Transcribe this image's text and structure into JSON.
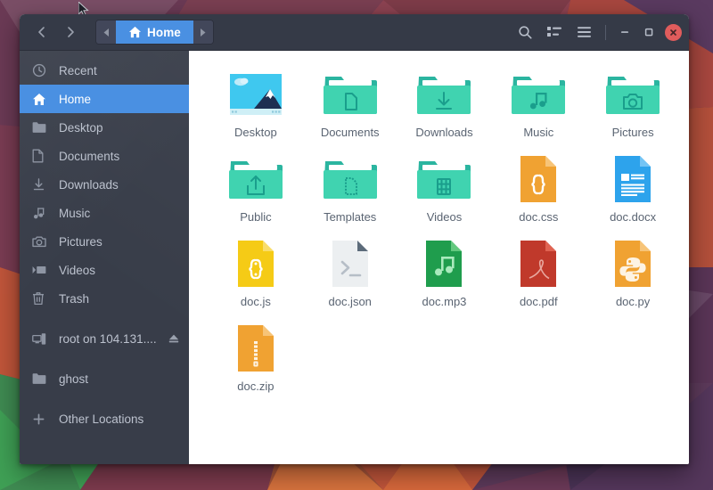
{
  "window": {
    "title": "Home",
    "accent_color": "#4a90e2",
    "headerbar_color": "#353a47",
    "sidebar_color": "#383d49",
    "close_color": "#e05c5c"
  },
  "headerbar": {
    "back_label": "Back",
    "forward_label": "Forward",
    "path_prev_label": "Previous path",
    "path_next_label": "Next path",
    "crumb_label": "Home",
    "search_label": "Search",
    "view_toggle_label": "List view",
    "menu_label": "Menu",
    "minimize_label": "Minimize",
    "maximize_label": "Maximize",
    "close_label": "Close"
  },
  "sidebar": {
    "items": [
      {
        "label": "Recent",
        "icon": "clock-icon",
        "selected": false,
        "gap_before": false,
        "eject": false
      },
      {
        "label": "Home",
        "icon": "home-icon",
        "selected": true,
        "gap_before": false,
        "eject": false
      },
      {
        "label": "Desktop",
        "icon": "folder-icon",
        "selected": false,
        "gap_before": false,
        "eject": false
      },
      {
        "label": "Documents",
        "icon": "document-icon",
        "selected": false,
        "gap_before": false,
        "eject": false
      },
      {
        "label": "Downloads",
        "icon": "download-icon",
        "selected": false,
        "gap_before": false,
        "eject": false
      },
      {
        "label": "Music",
        "icon": "music-icon",
        "selected": false,
        "gap_before": false,
        "eject": false
      },
      {
        "label": "Pictures",
        "icon": "camera-icon",
        "selected": false,
        "gap_before": false,
        "eject": false
      },
      {
        "label": "Videos",
        "icon": "video-icon",
        "selected": false,
        "gap_before": false,
        "eject": false
      },
      {
        "label": "Trash",
        "icon": "trash-icon",
        "selected": false,
        "gap_before": false,
        "eject": false
      },
      {
        "label": "root on 104.131....",
        "icon": "server-icon",
        "selected": false,
        "gap_before": true,
        "eject": true
      },
      {
        "label": "ghost",
        "icon": "folder-icon",
        "selected": false,
        "gap_before": true,
        "eject": false
      },
      {
        "label": "Other Locations",
        "icon": "plus-icon",
        "selected": false,
        "gap_before": true,
        "eject": false
      }
    ]
  },
  "files": {
    "items": [
      {
        "name": "Desktop",
        "icon": "wallpaper-thumbnail-icon"
      },
      {
        "name": "Documents",
        "icon": "folder-documents-icon"
      },
      {
        "name": "Downloads",
        "icon": "folder-downloads-icon"
      },
      {
        "name": "Music",
        "icon": "folder-music-icon"
      },
      {
        "name": "Pictures",
        "icon": "folder-pictures-icon"
      },
      {
        "name": "Public",
        "icon": "folder-public-icon"
      },
      {
        "name": "Templates",
        "icon": "folder-templates-icon"
      },
      {
        "name": "Videos",
        "icon": "folder-videos-icon"
      },
      {
        "name": "doc.css",
        "icon": "file-css-icon"
      },
      {
        "name": "doc.docx",
        "icon": "file-docx-icon"
      },
      {
        "name": "doc.js",
        "icon": "file-js-icon"
      },
      {
        "name": "doc.json",
        "icon": "file-json-icon"
      },
      {
        "name": "doc.mp3",
        "icon": "file-mp3-icon"
      },
      {
        "name": "doc.pdf",
        "icon": "file-pdf-icon"
      },
      {
        "name": "doc.py",
        "icon": "file-py-icon"
      },
      {
        "name": "doc.zip",
        "icon": "file-zip-icon"
      }
    ]
  }
}
